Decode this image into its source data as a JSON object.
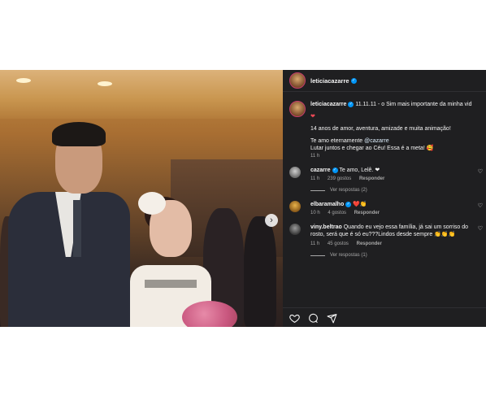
{
  "post": {
    "author": "leticiacazarre",
    "caption": {
      "line1": "11.11.11 - o Sim mais importante da minha vid",
      "line2": "14 anos de amor, aventura, amizade e muita animação!",
      "line3a": "Te amo eternamente ",
      "mention": "@cazarre",
      "line3b": "Lutar juntos e chegar ao Céu! Essa é a meta! 🥰",
      "time": "11 h"
    }
  },
  "comments": [
    {
      "user": "cazarre",
      "text": "Te amo, Lelê. ❤",
      "time": "11 h",
      "likes": "239 gostos",
      "reply": "Responder",
      "view_replies": "Ver respostas (2)"
    },
    {
      "user": "elbaramalho",
      "text": "❤️👏",
      "time": "10 h",
      "likes": "4 gostos",
      "reply": "Responder"
    },
    {
      "user": "viny.beltrao",
      "text_line1": "Quando eu vejo essa família, já sai um sorriso do",
      "text_line2": "rosto, será que é só eu???Lindos desde sempre 👏👏👏",
      "time": "11 h",
      "likes": "45 gostos",
      "reply": "Responder",
      "view_replies": "Ver respostas (1)"
    }
  ],
  "icons": {
    "like": "heart-icon",
    "comment": "comment-icon",
    "share": "share-icon",
    "next": "chevron-right-icon"
  },
  "colors": {
    "panel_bg": "#1f1f21",
    "verified": "#0095f6",
    "heart": "#ed4956"
  }
}
